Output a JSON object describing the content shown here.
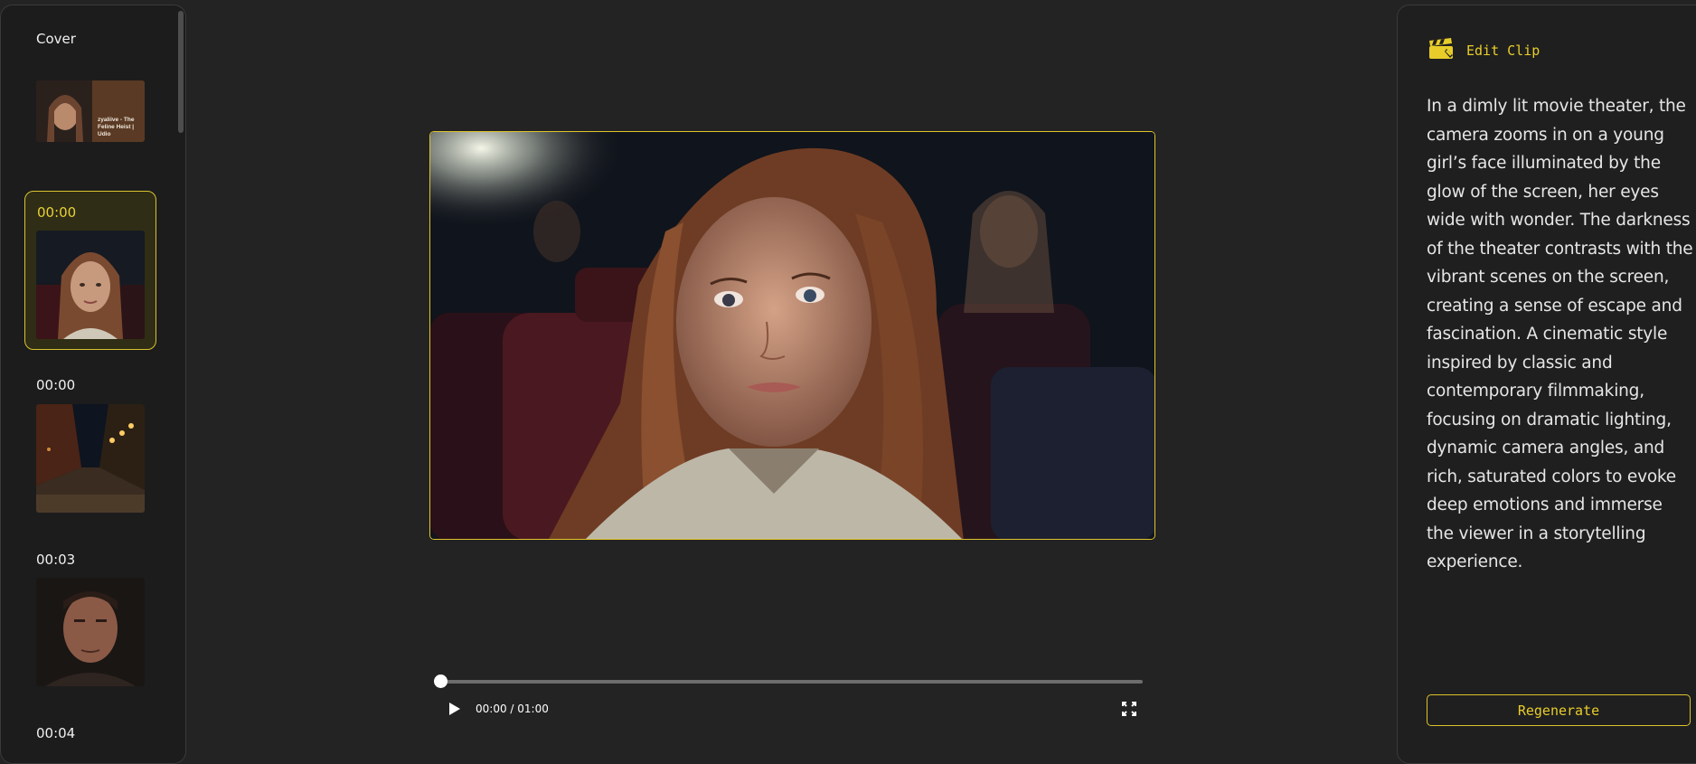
{
  "sidebar": {
    "cover_label": "Cover",
    "cover_thumb_caption": "zyaliive - The Feline Heist | Udio",
    "clips": [
      {
        "time": "00:00",
        "thumb": "girl-in-theater"
      },
      {
        "time": "00:00",
        "thumb": "night-cobblestone-street"
      },
      {
        "time": "00:03",
        "thumb": "man-portrait"
      },
      {
        "time": "00:04"
      }
    ]
  },
  "player": {
    "time_display": "00:00 / 01:00",
    "progress_fraction": 0,
    "play_icon": "play-icon",
    "fullscreen_icon": "fullscreen-icon"
  },
  "edit_panel": {
    "title": "Edit Clip",
    "icon": "clapperboard-icon",
    "prompt": "In a dimly lit movie theater, the camera zooms in on a young girl’s face illuminated by the glow of the screen, her eyes wide with wonder. The darkness of the theater contrasts with the vibrant scenes on the screen, creating a sense of escape and fascination. A cinematic style inspired by classic and contemporary filmmaking, focusing on dramatic lighting, dynamic camera angles, and rich, saturated colors to evoke deep emotions and immerse the viewer in a storytelling experience.",
    "regenerate_label": "Regenerate"
  },
  "colors": {
    "accent": "#e8cd2a",
    "background": "#232323",
    "panel": "#1c1c1c"
  }
}
